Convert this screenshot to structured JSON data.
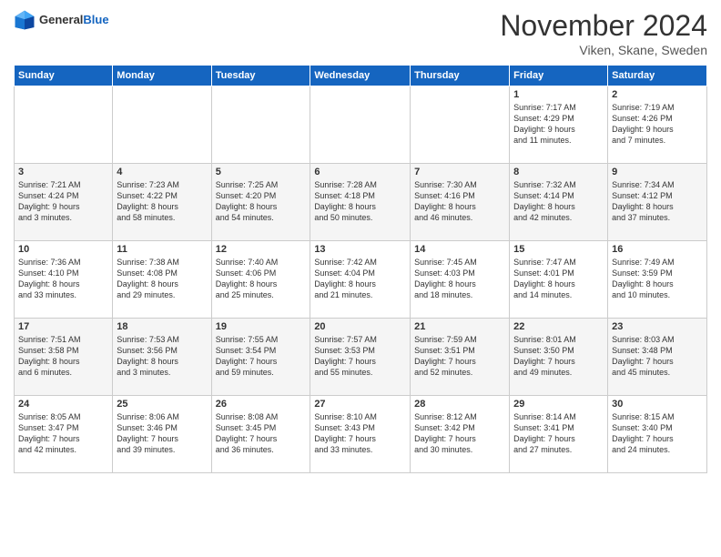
{
  "logo": {
    "general": "General",
    "blue": "Blue"
  },
  "header": {
    "title": "November 2024",
    "subtitle": "Viken, Skane, Sweden"
  },
  "weekdays": [
    "Sunday",
    "Monday",
    "Tuesday",
    "Wednesday",
    "Thursday",
    "Friday",
    "Saturday"
  ],
  "weeks": [
    [
      {
        "day": "",
        "info": ""
      },
      {
        "day": "",
        "info": ""
      },
      {
        "day": "",
        "info": ""
      },
      {
        "day": "",
        "info": ""
      },
      {
        "day": "",
        "info": ""
      },
      {
        "day": "1",
        "info": "Sunrise: 7:17 AM\nSunset: 4:29 PM\nDaylight: 9 hours\nand 11 minutes."
      },
      {
        "day": "2",
        "info": "Sunrise: 7:19 AM\nSunset: 4:26 PM\nDaylight: 9 hours\nand 7 minutes."
      }
    ],
    [
      {
        "day": "3",
        "info": "Sunrise: 7:21 AM\nSunset: 4:24 PM\nDaylight: 9 hours\nand 3 minutes."
      },
      {
        "day": "4",
        "info": "Sunrise: 7:23 AM\nSunset: 4:22 PM\nDaylight: 8 hours\nand 58 minutes."
      },
      {
        "day": "5",
        "info": "Sunrise: 7:25 AM\nSunset: 4:20 PM\nDaylight: 8 hours\nand 54 minutes."
      },
      {
        "day": "6",
        "info": "Sunrise: 7:28 AM\nSunset: 4:18 PM\nDaylight: 8 hours\nand 50 minutes."
      },
      {
        "day": "7",
        "info": "Sunrise: 7:30 AM\nSunset: 4:16 PM\nDaylight: 8 hours\nand 46 minutes."
      },
      {
        "day": "8",
        "info": "Sunrise: 7:32 AM\nSunset: 4:14 PM\nDaylight: 8 hours\nand 42 minutes."
      },
      {
        "day": "9",
        "info": "Sunrise: 7:34 AM\nSunset: 4:12 PM\nDaylight: 8 hours\nand 37 minutes."
      }
    ],
    [
      {
        "day": "10",
        "info": "Sunrise: 7:36 AM\nSunset: 4:10 PM\nDaylight: 8 hours\nand 33 minutes."
      },
      {
        "day": "11",
        "info": "Sunrise: 7:38 AM\nSunset: 4:08 PM\nDaylight: 8 hours\nand 29 minutes."
      },
      {
        "day": "12",
        "info": "Sunrise: 7:40 AM\nSunset: 4:06 PM\nDaylight: 8 hours\nand 25 minutes."
      },
      {
        "day": "13",
        "info": "Sunrise: 7:42 AM\nSunset: 4:04 PM\nDaylight: 8 hours\nand 21 minutes."
      },
      {
        "day": "14",
        "info": "Sunrise: 7:45 AM\nSunset: 4:03 PM\nDaylight: 8 hours\nand 18 minutes."
      },
      {
        "day": "15",
        "info": "Sunrise: 7:47 AM\nSunset: 4:01 PM\nDaylight: 8 hours\nand 14 minutes."
      },
      {
        "day": "16",
        "info": "Sunrise: 7:49 AM\nSunset: 3:59 PM\nDaylight: 8 hours\nand 10 minutes."
      }
    ],
    [
      {
        "day": "17",
        "info": "Sunrise: 7:51 AM\nSunset: 3:58 PM\nDaylight: 8 hours\nand 6 minutes."
      },
      {
        "day": "18",
        "info": "Sunrise: 7:53 AM\nSunset: 3:56 PM\nDaylight: 8 hours\nand 3 minutes."
      },
      {
        "day": "19",
        "info": "Sunrise: 7:55 AM\nSunset: 3:54 PM\nDaylight: 7 hours\nand 59 minutes."
      },
      {
        "day": "20",
        "info": "Sunrise: 7:57 AM\nSunset: 3:53 PM\nDaylight: 7 hours\nand 55 minutes."
      },
      {
        "day": "21",
        "info": "Sunrise: 7:59 AM\nSunset: 3:51 PM\nDaylight: 7 hours\nand 52 minutes."
      },
      {
        "day": "22",
        "info": "Sunrise: 8:01 AM\nSunset: 3:50 PM\nDaylight: 7 hours\nand 49 minutes."
      },
      {
        "day": "23",
        "info": "Sunrise: 8:03 AM\nSunset: 3:48 PM\nDaylight: 7 hours\nand 45 minutes."
      }
    ],
    [
      {
        "day": "24",
        "info": "Sunrise: 8:05 AM\nSunset: 3:47 PM\nDaylight: 7 hours\nand 42 minutes."
      },
      {
        "day": "25",
        "info": "Sunrise: 8:06 AM\nSunset: 3:46 PM\nDaylight: 7 hours\nand 39 minutes."
      },
      {
        "day": "26",
        "info": "Sunrise: 8:08 AM\nSunset: 3:45 PM\nDaylight: 7 hours\nand 36 minutes."
      },
      {
        "day": "27",
        "info": "Sunrise: 8:10 AM\nSunset: 3:43 PM\nDaylight: 7 hours\nand 33 minutes."
      },
      {
        "day": "28",
        "info": "Sunrise: 8:12 AM\nSunset: 3:42 PM\nDaylight: 7 hours\nand 30 minutes."
      },
      {
        "day": "29",
        "info": "Sunrise: 8:14 AM\nSunset: 3:41 PM\nDaylight: 7 hours\nand 27 minutes."
      },
      {
        "day": "30",
        "info": "Sunrise: 8:15 AM\nSunset: 3:40 PM\nDaylight: 7 hours\nand 24 minutes."
      }
    ]
  ]
}
